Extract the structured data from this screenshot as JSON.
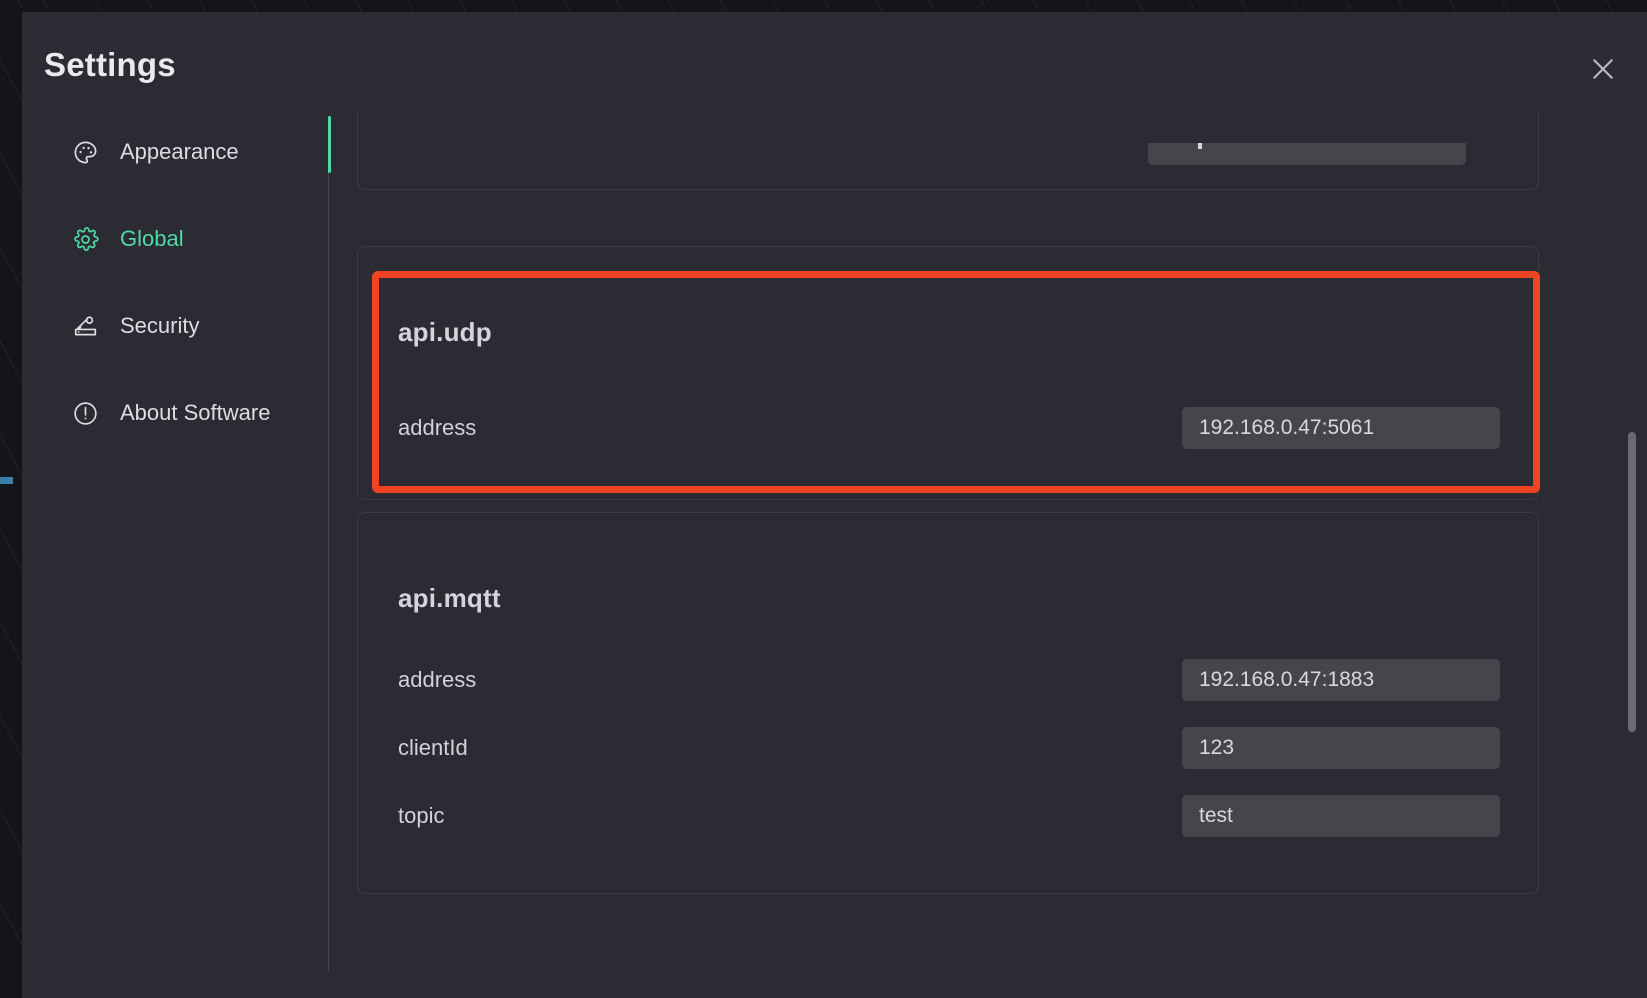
{
  "window": {
    "title": "Settings",
    "close_icon": "close-icon",
    "accent_color": "#52d8a4",
    "highlight_color": "#f04323",
    "background_color": "#2b2c33",
    "input_background_color": "#45464c"
  },
  "sidebar": {
    "items": [
      {
        "id": "appearance",
        "label": "Appearance",
        "icon": "palette-icon",
        "active": false
      },
      {
        "id": "global",
        "label": "Global",
        "icon": "gear-icon",
        "active": true
      },
      {
        "id": "security",
        "label": "Security",
        "icon": "key-card-icon",
        "active": false
      },
      {
        "id": "about",
        "label": "About Software",
        "icon": "info-circle-icon",
        "active": false
      }
    ]
  },
  "content": {
    "cards": [
      {
        "id": "partial-top",
        "title": "",
        "fields": [
          {
            "label": "",
            "value": "",
            "placeholder": ""
          }
        ]
      },
      {
        "id": "api-udp",
        "title": "api.udp",
        "fields": [
          {
            "label": "address",
            "value": "192.168.0.47:5061",
            "placeholder": ""
          }
        ]
      },
      {
        "id": "api-mqtt",
        "title": "api.mqtt",
        "fields": [
          {
            "label": "address",
            "value": "192.168.0.47:1883",
            "placeholder": ""
          },
          {
            "label": "clientId",
            "value": "123",
            "placeholder": ""
          },
          {
            "label": "topic",
            "value": "test",
            "placeholder": ""
          }
        ]
      }
    ]
  }
}
